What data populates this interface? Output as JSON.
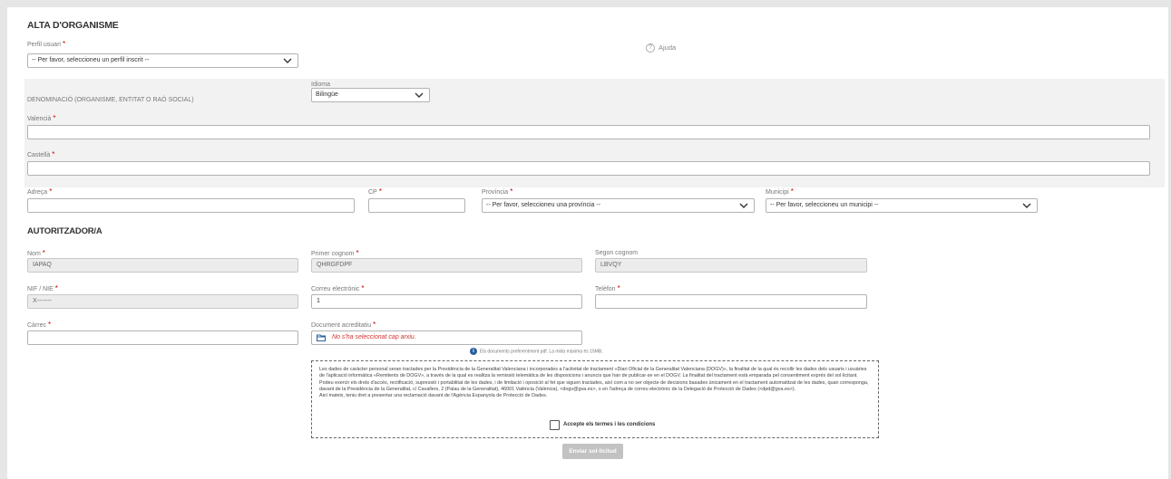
{
  "page": {
    "title": "ALTA D'ORGANISME",
    "help_label": "Ajuda",
    "help_icon": "question-circle-icon"
  },
  "profile": {
    "label": "Perfil usuari",
    "required_mark": "*",
    "selected": "-- Per favor, seleccioneu un perfil inscrit --"
  },
  "denomination": {
    "label": "DENOMINACIÓ (ORGANISME, ENTITAT O RAÓ SOCIAL)",
    "language_label": "Idioma",
    "language_selected": "Bilingüe",
    "valencian_label": "Valencià",
    "valencian_value": "",
    "spanish_label": "Castellà",
    "spanish_value": ""
  },
  "address": {
    "address_label": "Adreça",
    "address_value": "",
    "cp_label": "CP",
    "cp_value": "",
    "province_label": "Província",
    "province_selected": "-- Per favor, seleccioneu una província --",
    "municipality_label": "Municipi",
    "municipality_selected": "-- Per favor, seleccioneu un municipi --"
  },
  "authorizer": {
    "title": "AUTORITZADOR/A",
    "name_label": "Nom",
    "name_value": "IAPAQ",
    "first_surname_label": "Primer cognom",
    "first_surname_value": "QHRGFDPF",
    "second_surname_label": "Segon cognom",
    "second_surname_value": "LBVQY",
    "nif_label": "NIF / NIE",
    "nif_value": "X-------",
    "email_label": "Correu electrònic",
    "email_value": "1",
    "phone_label": "Telèfon",
    "phone_value": "",
    "position_label": "Càrrec",
    "position_value": "",
    "doc_label": "Document acreditatiu",
    "doc_value": "No s'ha seleccionat cap arxiu.",
    "doc_note": "Els documents preferentment pdf. La mida màxima és 15MB."
  },
  "terms": {
    "paragraphs": [
      "Les dades de caràcter personal seran tractades per la Presidència de la Generalitat Valenciana i incorporades a l'activitat de tractament «Diari Oficial de la Generalitat Valenciana (DOGV)», la finalitat de la qual és recollir les dades dels usuaris i usuàries de l'aplicació informàtica «Remitents de DOGV», a través de la qual es realitza la remissió telemàtica de les disposicions i anuncis que han de publicar-se en el DOGV. La finalitat del tractament està emparada pel consentiment exprés del sol·licitant.",
      "Podeu exercir els drets d'accés, rectificació, supressió i portabilitat de les dades, i de limitació i oposició al fet que siguen tractades, així com a no ser objecte de decisions basades únicament en el tractament automatitzat de les dades, quan corresponga, davant de la Presidència de la Generalitat, c/ Cavallers, 2 (Palau de la Generalitat), 46001 València (València), <dogv@gva.es>, o en l'adreça de correu electrònic de la Delegació de Protecció de Dades (<dpd@gva.es>).",
      "Així mateix, teniu dret a presentar una reclamació davant de l'Agència Espanyola de Protecció de Dades."
    ],
    "accept_label": "Accepte els termes i les condicions",
    "accept_checked": false
  },
  "submit_label": "Enviar sol·licitud",
  "colors": {
    "required": "#cc0000",
    "band": "#f2f2f2",
    "submit_disabled": "#c2c2c2",
    "file_text": "#cc3333"
  }
}
